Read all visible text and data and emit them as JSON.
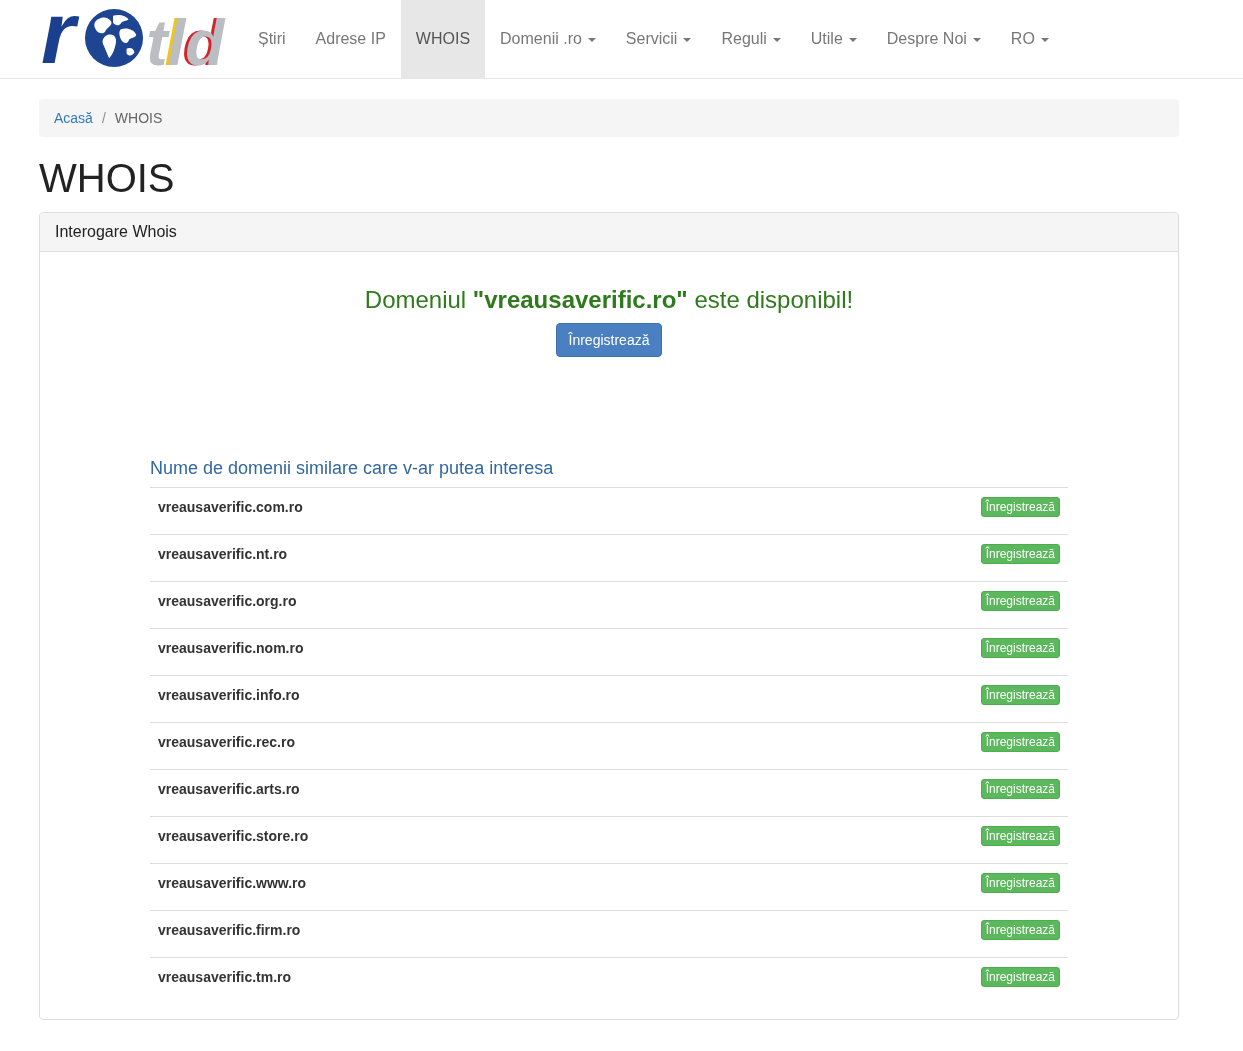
{
  "logo": {
    "left": "r",
    "right": "tld"
  },
  "nav": [
    {
      "label": "Știri",
      "dropdown": false,
      "selected": false
    },
    {
      "label": "Adrese IP",
      "dropdown": false,
      "selected": false
    },
    {
      "label": "WHOIS",
      "dropdown": false,
      "selected": true
    },
    {
      "label": "Domenii .ro",
      "dropdown": true,
      "selected": false
    },
    {
      "label": "Servicii",
      "dropdown": true,
      "selected": false
    },
    {
      "label": "Reguli",
      "dropdown": true,
      "selected": false
    },
    {
      "label": "Utile",
      "dropdown": true,
      "selected": false
    },
    {
      "label": "Despre Noi",
      "dropdown": true,
      "selected": false
    },
    {
      "label": "RO",
      "dropdown": true,
      "selected": false
    }
  ],
  "breadcrumb": {
    "separator": "/",
    "items": [
      {
        "label": "Acasă",
        "current": false
      },
      {
        "label": "WHOIS",
        "current": true
      }
    ]
  },
  "page_title": "WHOIS",
  "panel": {
    "title": "Interogare Whois",
    "message": "Domeniul **\"vreausaverific.ro\"** este disponibil!",
    "register_button": "Înregistrează",
    "similar": {
      "title": "Nume de domenii similare care v-ar putea interesa",
      "rows": [
        {
          "domain": "vreausaverific.com.ro",
          "button": "Înregistrează"
        },
        {
          "domain": "vreausaverific.nt.ro",
          "button": "Înregistrează"
        },
        {
          "domain": "vreausaverific.org.ro",
          "button": "Înregistrează"
        },
        {
          "domain": "vreausaverific.nom.ro",
          "button": "Înregistrează"
        },
        {
          "domain": "vreausaverific.info.ro",
          "button": "Înregistrează"
        },
        {
          "domain": "vreausaverific.rec.ro",
          "button": "Înregistrează"
        },
        {
          "domain": "vreausaverific.arts.ro",
          "button": "Înregistrează"
        },
        {
          "domain": "vreausaverific.store.ro",
          "button": "Înregistrează"
        },
        {
          "domain": "vreausaverific.www.ro",
          "button": "Înregistrează"
        },
        {
          "domain": "vreausaverific.firm.ro",
          "button": "Înregistrează"
        },
        {
          "domain": "vreausaverific.tm.ro",
          "button": "Înregistrează"
        }
      ]
    }
  }
}
